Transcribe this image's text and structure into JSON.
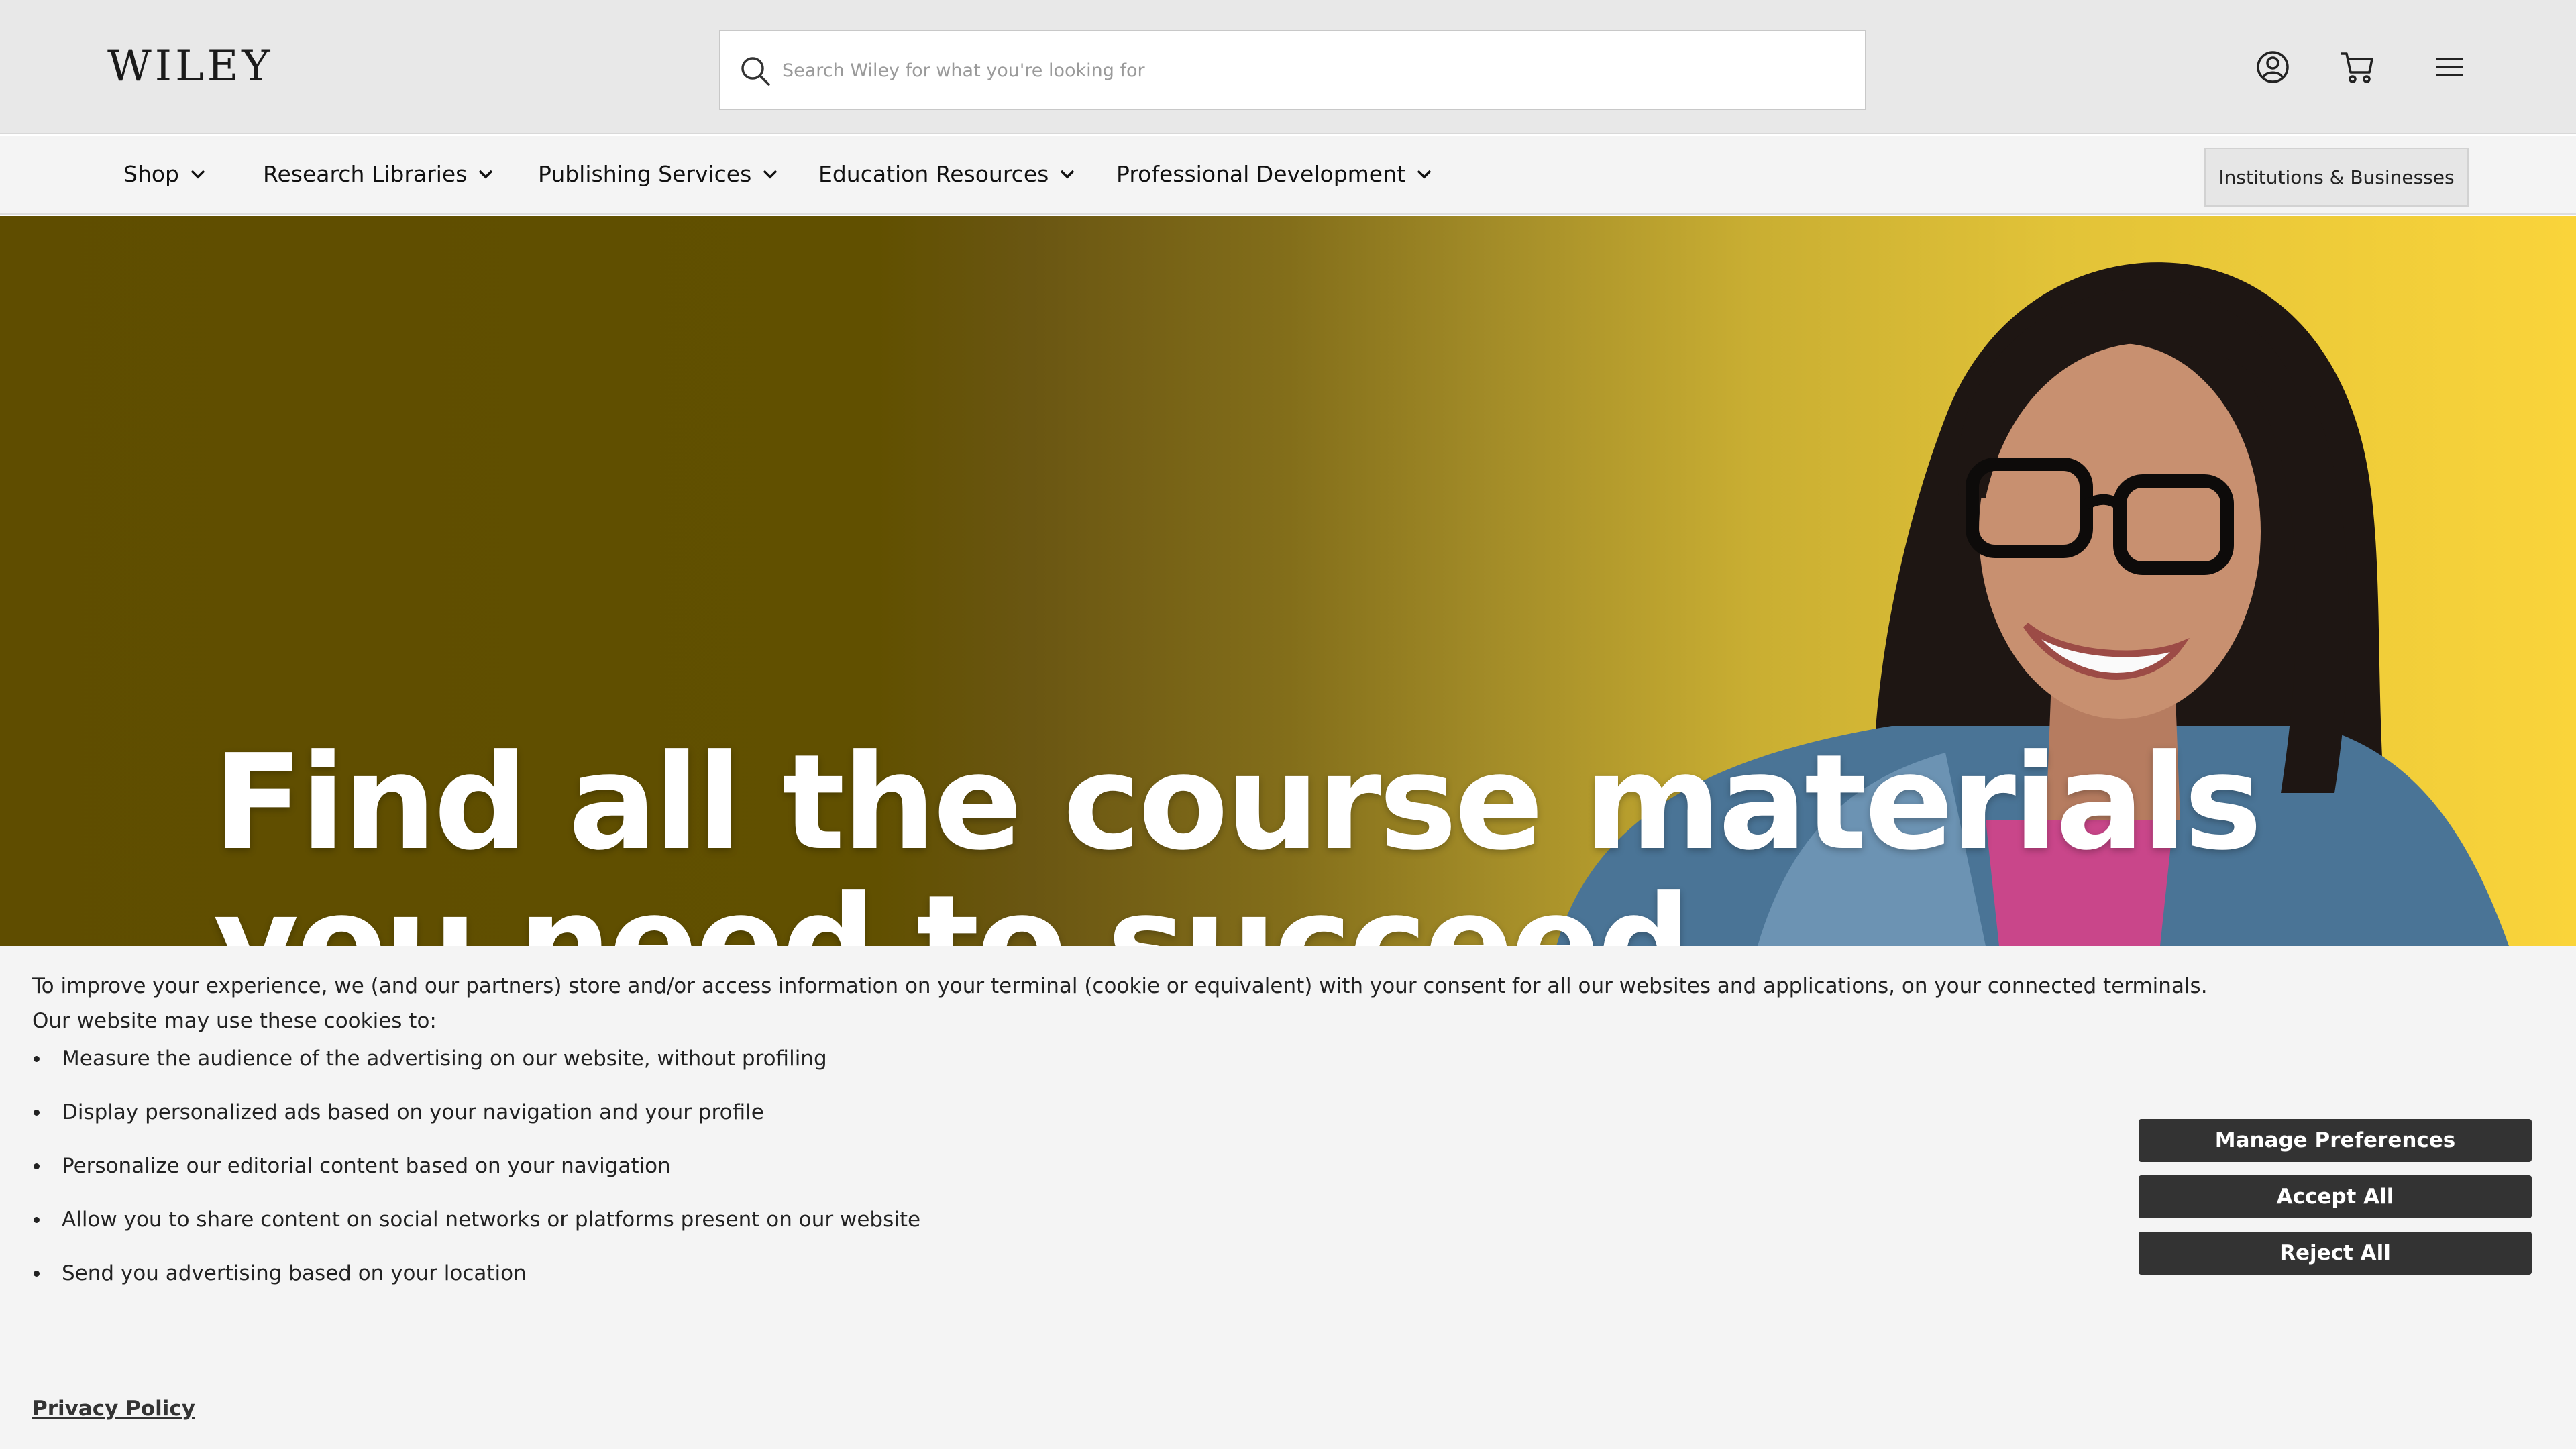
{
  "header": {
    "logo_text": "WILEY",
    "search_placeholder": "Search Wiley for what you're looking for",
    "icons": [
      "search-icon",
      "account-icon",
      "cart-icon",
      "menu-icon"
    ]
  },
  "nav": {
    "items": [
      {
        "label": "Shop"
      },
      {
        "label": "Research Libraries"
      },
      {
        "label": "Publishing Services"
      },
      {
        "label": "Education Resources"
      },
      {
        "label": "Professional Development"
      }
    ],
    "institutions_label": "Institutions & Businesses"
  },
  "hero": {
    "title": "Find all the course materials you need to succeed"
  },
  "cookie_banner": {
    "intro": "To improve your experience, we (and our partners) store and/or access information on your terminal (cookie or equivalent) with your consent for all our websites and applications, on your connected terminals.",
    "subtitle": "Our website may use these cookies to:",
    "items": [
      "Measure the audience of the advertising on our website, without profiling",
      "Display personalized ads based on your navigation and your profile",
      "Personalize our editorial content based on your navigation",
      "Allow you to share content on social networks or platforms present on our website",
      "Send you advertising based on your location"
    ],
    "privacy_link": "Privacy Policy",
    "buttons": {
      "manage": "Manage Preferences",
      "accept": "Accept All",
      "reject": "Reject All"
    }
  },
  "colors": {
    "hero_dark": "#5f4d00",
    "hero_bright": "#fad43a",
    "button_dark": "#333333",
    "banner_bg": "#f4f4f4"
  }
}
